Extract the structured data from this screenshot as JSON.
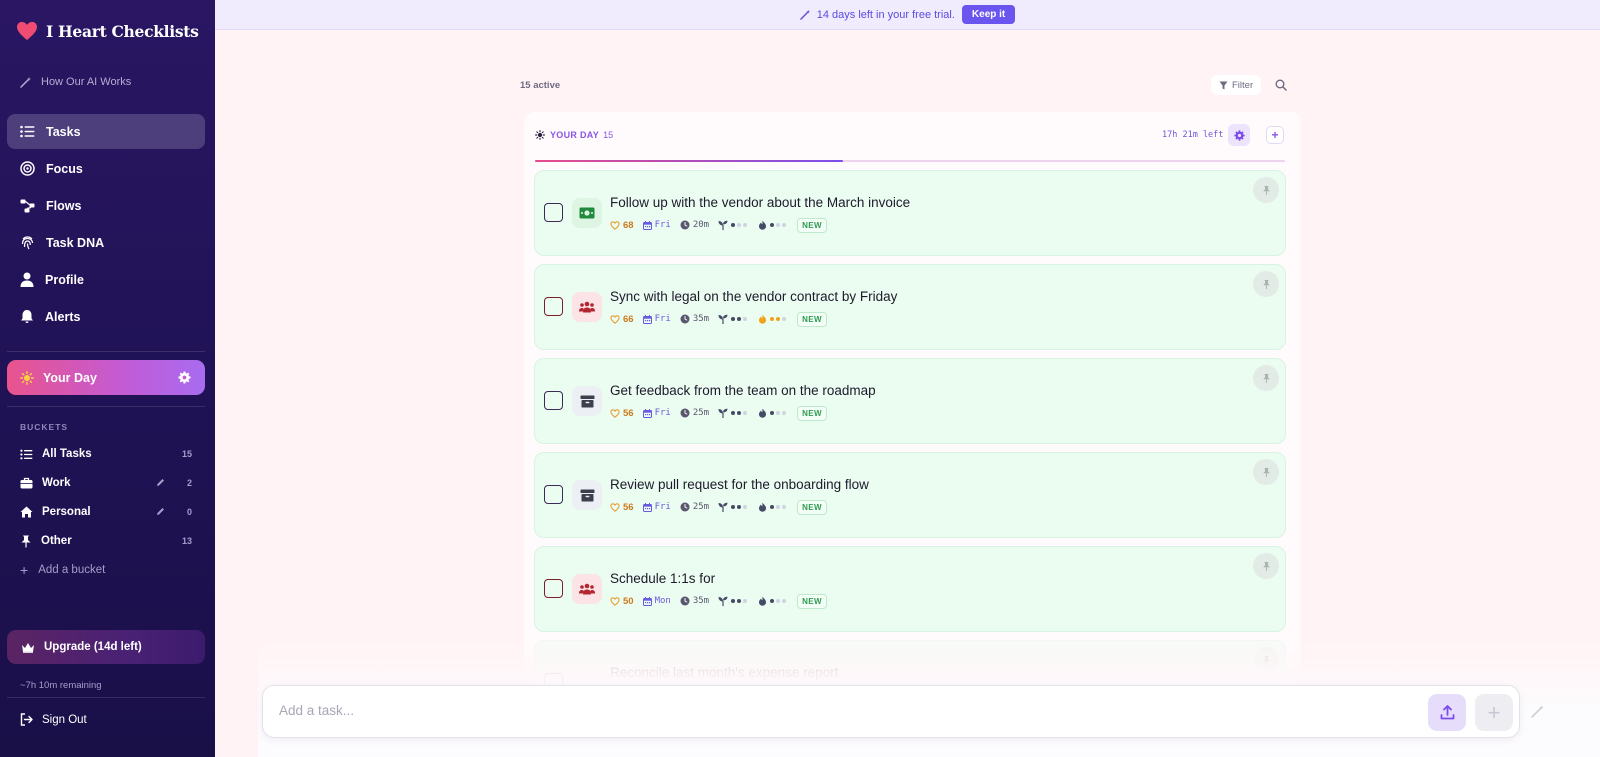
{
  "app": {
    "name": "I Heart Checklists"
  },
  "sidebar": {
    "ai_link": "How Our AI Works",
    "nav": [
      {
        "label": "Tasks",
        "icon": "list-icon",
        "active": true
      },
      {
        "label": "Focus",
        "icon": "target-icon",
        "active": false
      },
      {
        "label": "Flows",
        "icon": "flow-icon",
        "active": false
      },
      {
        "label": "Task DNA",
        "icon": "fingerprint-icon",
        "active": false
      },
      {
        "label": "Profile",
        "icon": "user-icon",
        "active": false
      },
      {
        "label": "Alerts",
        "icon": "bell-icon",
        "active": false
      }
    ],
    "your_day": "Your Day",
    "buckets_title": "BUCKETS",
    "buckets": [
      {
        "label": "All Tasks",
        "count": "15"
      },
      {
        "label": "Work",
        "count": "2"
      },
      {
        "label": "Personal",
        "count": "0"
      },
      {
        "label": "Other",
        "count": "13"
      }
    ],
    "add_bucket": "Add a bucket",
    "upgrade": "Upgrade (14d left)",
    "remaining": "~7h 10m remaining",
    "sign_out": "Sign Out"
  },
  "banner": {
    "text": "14 days left in your free trial.",
    "button": "Keep it"
  },
  "toolbar": {
    "active": "15 active",
    "filter": "Filter"
  },
  "day": {
    "label": "YOUR DAY",
    "count": "15",
    "time_left": "17h 21m left",
    "progress": 0.41
  },
  "tasks": [
    {
      "title": "Follow up with the vendor about the March invoice",
      "score": "68",
      "day": "Fri",
      "duration": "20m",
      "icon": "money-icon",
      "energy": 1,
      "heat": 1,
      "heat_warm": false,
      "badge": "NEW"
    },
    {
      "title": "Sync with legal on the vendor contract by Friday",
      "score": "66",
      "day": "Fri",
      "duration": "35m",
      "icon": "people-icon",
      "energy": 2,
      "heat": 2,
      "heat_warm": true,
      "badge": "NEW"
    },
    {
      "title": "Get feedback from the team on the roadmap",
      "score": "56",
      "day": "Fri",
      "duration": "25m",
      "icon": "archive-icon",
      "energy": 2,
      "heat": 1,
      "heat_warm": false,
      "badge": "NEW"
    },
    {
      "title": "Review pull request for the onboarding flow",
      "score": "56",
      "day": "Fri",
      "duration": "25m",
      "icon": "archive-icon",
      "energy": 2,
      "heat": 1,
      "heat_warm": false,
      "badge": "NEW"
    },
    {
      "title": "Schedule 1:1s for",
      "score": "50",
      "day": "Mon",
      "duration": "35m",
      "icon": "people-icon",
      "energy": 2,
      "heat": 1,
      "heat_warm": false,
      "badge": "NEW"
    },
    {
      "title": "Reconcile last month's expense report",
      "score": "",
      "day": "",
      "duration": "",
      "icon": "",
      "energy": 0,
      "heat": 0,
      "heat_warm": false,
      "badge": ""
    }
  ],
  "add_task": {
    "placeholder": "Add a task..."
  },
  "colors": {
    "accent": "#6a55ee",
    "sidebar": "#1f1254",
    "task_bg": "#ebfcf1",
    "page_bg": "#fff3f5"
  }
}
